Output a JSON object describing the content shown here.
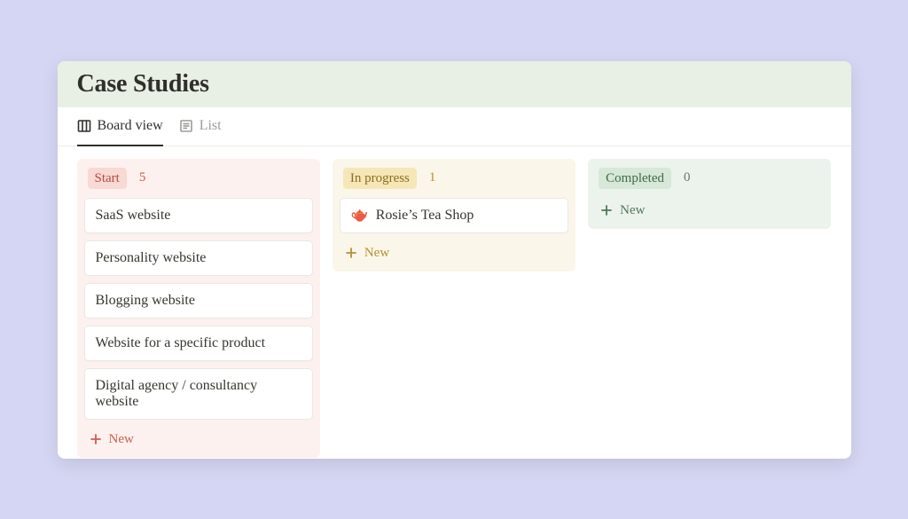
{
  "page": {
    "title": "Case Studies"
  },
  "views": {
    "board": {
      "label": "Board view"
    },
    "list": {
      "label": "List"
    }
  },
  "columns": {
    "start": {
      "tag": "Start",
      "count": "5",
      "new_label": "New",
      "cards": [
        {
          "title": "SaaS website"
        },
        {
          "title": "Personality website"
        },
        {
          "title": "Blogging website"
        },
        {
          "title": "Website for a specific product"
        },
        {
          "title": "Digital agency / consultancy website"
        }
      ]
    },
    "progress": {
      "tag": "In progress",
      "count": "1",
      "new_label": "New",
      "cards": [
        {
          "emoji": "🫖",
          "title": "Rosie’s Tea Shop"
        }
      ]
    },
    "completed": {
      "tag": "Completed",
      "count": "0",
      "new_label": "New",
      "cards": []
    }
  }
}
